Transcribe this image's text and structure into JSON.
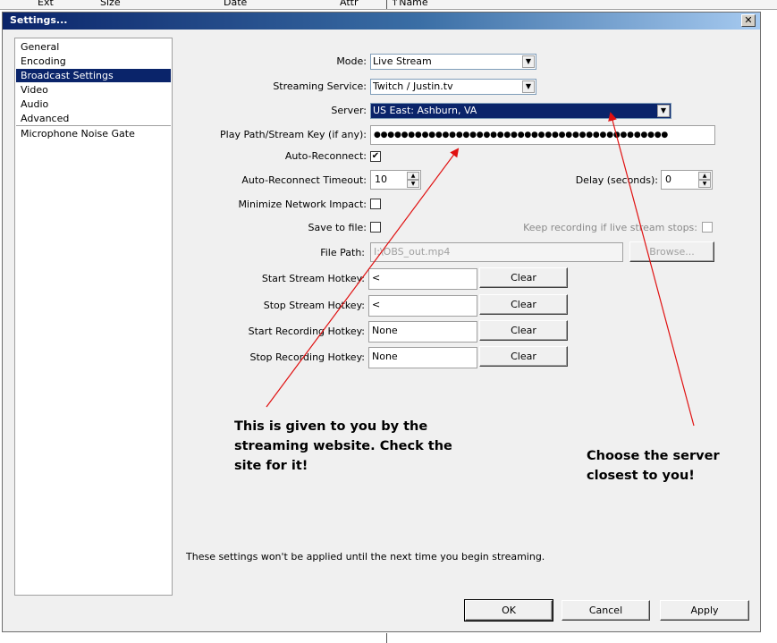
{
  "background": {
    "columns": [
      "Ext",
      "Size",
      "Date",
      "Attr",
      "↑Name"
    ]
  },
  "window": {
    "title": "Settings...",
    "close_glyph": "✕"
  },
  "sidebar": {
    "items": [
      {
        "label": "General"
      },
      {
        "label": "Encoding"
      },
      {
        "label": "Broadcast Settings",
        "selected": true
      },
      {
        "label": "Video"
      },
      {
        "label": "Audio"
      },
      {
        "label": "Advanced"
      },
      {
        "label": "Microphone Noise Gate"
      }
    ]
  },
  "form": {
    "mode": {
      "label": "Mode:",
      "value": "Live Stream"
    },
    "streaming_service": {
      "label": "Streaming Service:",
      "value": "Twitch / Justin.tv"
    },
    "server": {
      "label": "Server:",
      "value": "US East: Ashburn, VA"
    },
    "stream_key": {
      "label": "Play Path/Stream Key (if any):",
      "value": "●●●●●●●●●●●●●●●●●●●●●●●●●●●●●●●●●●●●●●●●●●●"
    },
    "auto_reconnect": {
      "label": "Auto-Reconnect:",
      "checked": true
    },
    "auto_reconnect_timeout": {
      "label": "Auto-Reconnect Timeout:",
      "value": "10"
    },
    "delay": {
      "label": "Delay (seconds):",
      "value": "0"
    },
    "minimize_network_impact": {
      "label": "Minimize Network Impact:",
      "checked": false
    },
    "save_to_file": {
      "label": "Save to file:",
      "checked": false
    },
    "keep_recording": {
      "label": "Keep recording if live stream stops:",
      "checked": false
    },
    "file_path": {
      "label": "File Path:",
      "value": "I:\\OBS_out.mp4",
      "browse_label": "Browse..."
    },
    "hotkeys": [
      {
        "label": "Start Stream Hotkey:",
        "value": "<",
        "clear_label": "Clear"
      },
      {
        "label": "Stop Stream Hotkey:",
        "value": "<",
        "clear_label": "Clear"
      },
      {
        "label": "Start Recording Hotkey:",
        "value": "None",
        "clear_label": "Clear"
      },
      {
        "label": "Stop Recording Hotkey:",
        "value": "None",
        "clear_label": "Clear"
      }
    ]
  },
  "note": "These settings won't be applied until the next time you begin streaming.",
  "buttons": {
    "ok": "OK",
    "cancel": "Cancel",
    "apply": "Apply"
  },
  "annotations": {
    "stream_key_note": [
      "This is given to you by the",
      "streaming website. Check the",
      "site for it!"
    ],
    "server_note": [
      "Choose the server",
      "closest to you!"
    ],
    "arrow_color": "#e01010"
  }
}
